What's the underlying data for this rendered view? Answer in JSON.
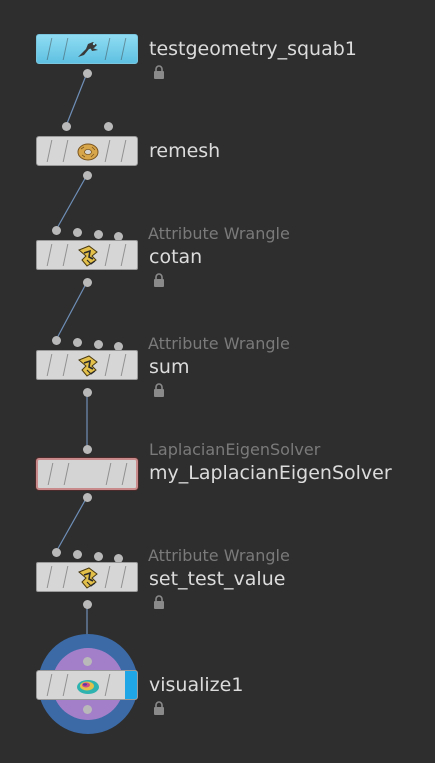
{
  "nodes": [
    {
      "name": "testgeometry_squab1",
      "type": "",
      "icon": "squab-icon",
      "locked": true
    },
    {
      "name": "remesh",
      "type": "",
      "icon": "donut-icon",
      "locked": false
    },
    {
      "name": "cotan",
      "type": "Attribute Wrangle",
      "icon": "wrangle-icon",
      "locked": true
    },
    {
      "name": "sum",
      "type": "Attribute Wrangle",
      "icon": "wrangle-icon",
      "locked": true
    },
    {
      "name": "my_LaplacianEigenSolver",
      "type": "LaplacianEigenSolver",
      "icon": "",
      "locked": false
    },
    {
      "name": "set_test_value",
      "type": "Attribute Wrangle",
      "icon": "wrangle-icon",
      "locked": true
    },
    {
      "name": "visualize1",
      "type": "",
      "icon": "visualize-icon",
      "locked": true,
      "display_flag": true
    }
  ],
  "colors": {
    "background": "#2e2e2e",
    "wire": "#6f8fb8",
    "display_flag": "#1fa6e6",
    "geometry_node": "#8fdcf2",
    "selected_outline": "#c88a8a",
    "visualize_ring": "#3b6aa6",
    "visualize_inner": "#a47fc9"
  }
}
